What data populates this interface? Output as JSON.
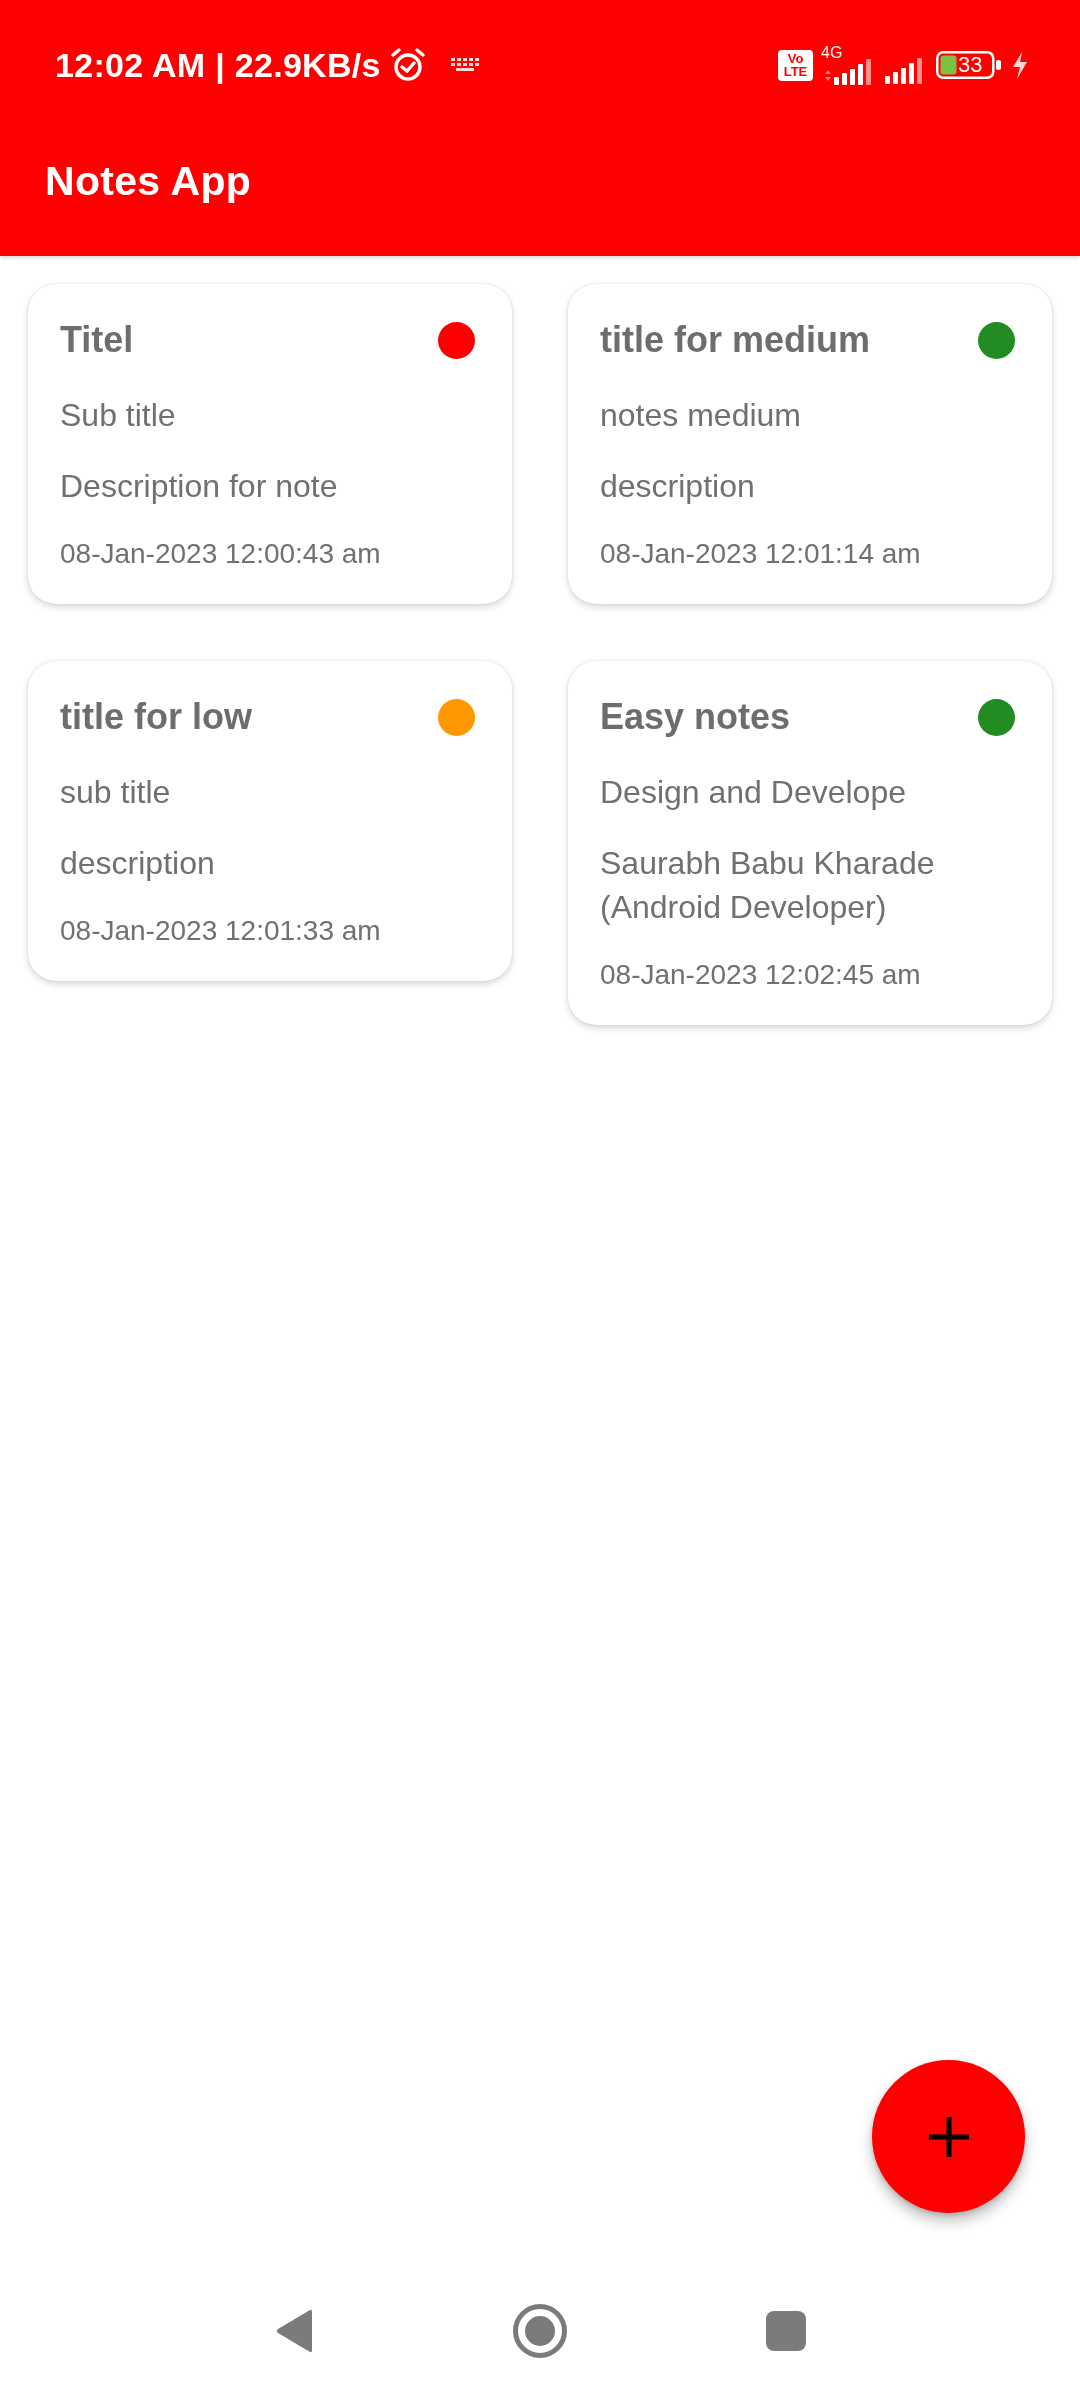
{
  "status_bar": {
    "time_speed": "12:02 AM | 22.9KB/s",
    "network_badge": [
      "Vo",
      "LTE"
    ],
    "network_type": "4G",
    "battery": "33"
  },
  "app_bar": {
    "title": "Notes App"
  },
  "notes": [
    {
      "title": "Titel",
      "subtitle": "Sub title",
      "description": "Description for note",
      "date": "08-Jan-2023 12:00:43 am",
      "color": "#ff0000"
    },
    {
      "title": "title for medium",
      "subtitle": "notes medium",
      "description": "description",
      "date": "08-Jan-2023 12:01:14 am",
      "color": "#228b22"
    },
    {
      "title": "title for low",
      "subtitle": "sub title",
      "description": "description",
      "date": "08-Jan-2023 12:01:33 am",
      "color": "#ff9800"
    },
    {
      "title": "Easy notes",
      "subtitle": "Design and Develope",
      "description": "Saurabh Babu Kharade (Android Developer)",
      "date": "08-Jan-2023 12:02:45 am",
      "color": "#228b22"
    }
  ]
}
